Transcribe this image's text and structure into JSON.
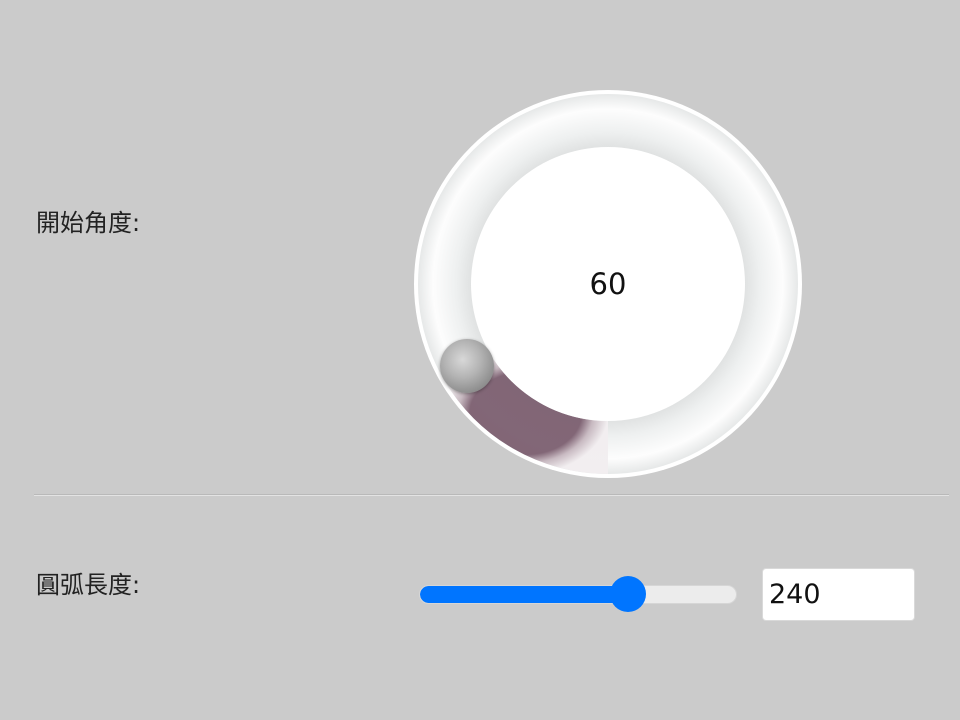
{
  "start_angle": {
    "label": "開始角度:",
    "value": "60",
    "value_num": 60
  },
  "arc_length": {
    "label": "圓弧長度:",
    "value": "240",
    "value_num": 240,
    "min": 0,
    "max": 360
  },
  "colors": {
    "background": "#cbcbcb",
    "slider_accent": "#0075ff",
    "arc_fill": "#8e6f80",
    "knob_ring": "#f4f4f4"
  },
  "icons": {
    "knob_handle": "knob-handle"
  }
}
